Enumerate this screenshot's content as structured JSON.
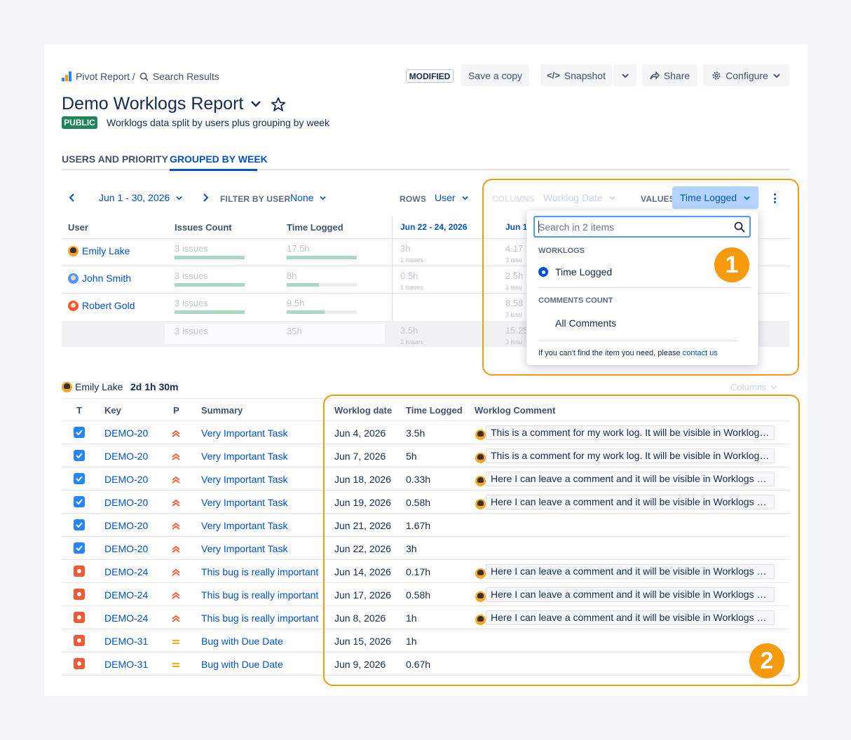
{
  "breadcrumb": {
    "root": "Pivot Report /",
    "current": "Search Results"
  },
  "toolbar": {
    "modified": "MODIFIED",
    "save_copy": "Save a copy",
    "snapshot": "Snapshot",
    "share": "Share",
    "configure": "Configure"
  },
  "report": {
    "title": "Demo Worklogs Report",
    "visibility": "PUBLIC",
    "description": "Worklogs data split by users plus grouping by week"
  },
  "tabs": [
    {
      "label": "USERS AND PRIORITY",
      "active": false
    },
    {
      "label": "GROUPED BY WEEK",
      "active": true
    }
  ],
  "controls": {
    "date_range": "Jun 1 - 30, 2026",
    "filter_label": "FILTER BY USER",
    "filter_value": "None",
    "rows_label": "ROWS",
    "rows_value": "User",
    "columns_label": "COLUMNS",
    "columns_value": "Worklog Date",
    "values_label": "VALUES",
    "values_value": "Time Logged"
  },
  "pivot": {
    "headers": [
      "User",
      "Issues Count",
      "Time Logged",
      "Jun 22 - 24, 2026",
      "Jun 1"
    ],
    "rows": [
      {
        "user": "Emily Lake",
        "issues": "3 issues",
        "issues_fill": 1.0,
        "time": "17.5h",
        "time_fill": 1.0,
        "c1": "3h",
        "c1_sub": "1 issues",
        "c2": "4.17",
        "c2_sub": "3 issu"
      },
      {
        "user": "John Smith",
        "issues": "3 issues",
        "issues_fill": 1.0,
        "time": "8h",
        "time_fill": 0.46,
        "c1": "0.5h",
        "c1_sub": "1 issues",
        "c2": "2.5h",
        "c2_sub": "2 issu"
      },
      {
        "user": "Robert Gold",
        "issues": "3 issues",
        "issues_fill": 1.0,
        "time": "9.5h",
        "time_fill": 0.54,
        "c1": "",
        "c1_sub": "",
        "c2": "8.58",
        "c2_sub": "3 issu"
      }
    ],
    "total": {
      "issues": "3 issues",
      "time": "35h",
      "c1": "3.5h",
      "c1_sub": "2 issues",
      "c2": "15.25",
      "c2_sub": "3 issu"
    }
  },
  "dropdown": {
    "search_placeholder": "Search in 2 items",
    "group1": "WORKLOGS",
    "item1": "Time Logged",
    "group2": "COMMENTS COUNT",
    "item2": "All Comments",
    "footer_text": "If you can't find the item you need, please",
    "footer_link": "contact us"
  },
  "badges": {
    "one": "1",
    "two": "2"
  },
  "detail": {
    "user": "Emily Lake",
    "total": "2d 1h 30m",
    "columns_btn": "Columns",
    "headers": [
      "T",
      "Key",
      "P",
      "Summary",
      "Worklog date",
      "Time Logged",
      "Worklog Comment"
    ],
    "rows": [
      {
        "type": "task",
        "key": "DEMO-20",
        "prio": "high",
        "summary": "Very Important Task",
        "date": "Jun 4, 2026",
        "time": "3.5h",
        "comment": "This is a comment for my work log. It will be visible in Worklogs Report"
      },
      {
        "type": "task",
        "key": "DEMO-20",
        "prio": "high",
        "summary": "Very Important Task",
        "date": "Jun 7, 2026",
        "time": "5h",
        "comment": "This is a comment for my work log. It will be visible in Worklogs Report"
      },
      {
        "type": "task",
        "key": "DEMO-20",
        "prio": "high",
        "summary": "Very Important Task",
        "date": "Jun 18, 2026",
        "time": "0.33h",
        "comment": "Here I can leave a comment and it will be visible in Worklogs Report"
      },
      {
        "type": "task",
        "key": "DEMO-20",
        "prio": "high",
        "summary": "Very Important Task",
        "date": "Jun 19, 2026",
        "time": "0.58h",
        "comment": "Here I can leave a comment and it will be visible in Worklogs Report"
      },
      {
        "type": "task",
        "key": "DEMO-20",
        "prio": "high",
        "summary": "Very Important Task",
        "date": "Jun 21, 2026",
        "time": "1.67h",
        "comment": ""
      },
      {
        "type": "task",
        "key": "DEMO-20",
        "prio": "high",
        "summary": "Very Important Task",
        "date": "Jun 22, 2026",
        "time": "3h",
        "comment": ""
      },
      {
        "type": "bug",
        "key": "DEMO-24",
        "prio": "high",
        "summary": "This bug is really important",
        "date": "Jun 14, 2026",
        "time": "0.17h",
        "comment": "Here I can leave a comment and it will be visible in Worklogs Report"
      },
      {
        "type": "bug",
        "key": "DEMO-24",
        "prio": "high",
        "summary": "This bug is really important",
        "date": "Jun 17, 2026",
        "time": "0.58h",
        "comment": "Here I can leave a comment and it will be visible in Worklogs Report"
      },
      {
        "type": "bug",
        "key": "DEMO-24",
        "prio": "high",
        "summary": "This bug is really important",
        "date": "Jun 8, 2026",
        "time": "1h",
        "comment": "Here I can leave a comment and it will be visible in Worklogs Report"
      },
      {
        "type": "bug",
        "key": "DEMO-31",
        "prio": "medium",
        "summary": "Bug with Due Date",
        "date": "Jun 15, 2026",
        "time": "1h",
        "comment": ""
      },
      {
        "type": "bug",
        "key": "DEMO-31",
        "prio": "medium",
        "summary": "Bug with Due Date",
        "date": "Jun 9, 2026",
        "time": "0.67h",
        "comment": ""
      }
    ]
  },
  "colors": {
    "accent": "#0052cc",
    "highlight": "#f59a0c",
    "public": "#1f845a",
    "bug": "#f15a36",
    "task": "#2684ff"
  }
}
